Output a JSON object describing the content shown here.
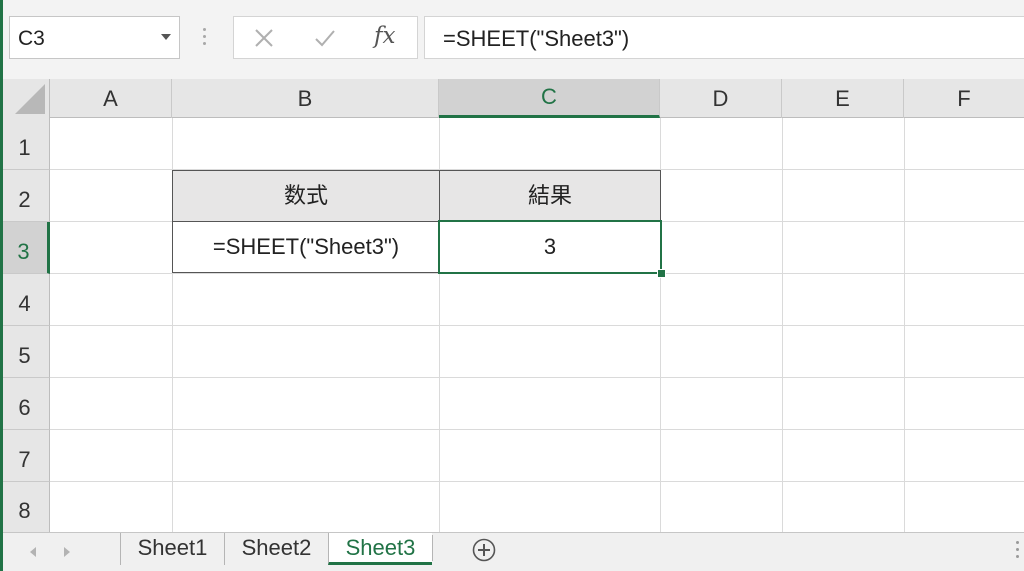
{
  "formula_bar": {
    "name_box": "C3",
    "fx_label": "fx",
    "formula": "=SHEET(\"Sheet3\")"
  },
  "columns": [
    "A",
    "B",
    "C",
    "D",
    "E",
    "F"
  ],
  "rows": [
    "1",
    "2",
    "3",
    "4",
    "5",
    "6",
    "7",
    "8"
  ],
  "selected_cell": "C3",
  "table": {
    "headers": [
      "数式",
      "結果"
    ],
    "row": [
      "=SHEET(\"Sheet3\")",
      "3"
    ]
  },
  "sheet_tabs": [
    {
      "label": "Sheet1",
      "active": false
    },
    {
      "label": "Sheet2",
      "active": false
    },
    {
      "label": "Sheet3",
      "active": true
    }
  ],
  "colors": {
    "accent": "#217346",
    "header_bg": "#e6e6e6",
    "table_header_bg": "#e7e6e6"
  }
}
